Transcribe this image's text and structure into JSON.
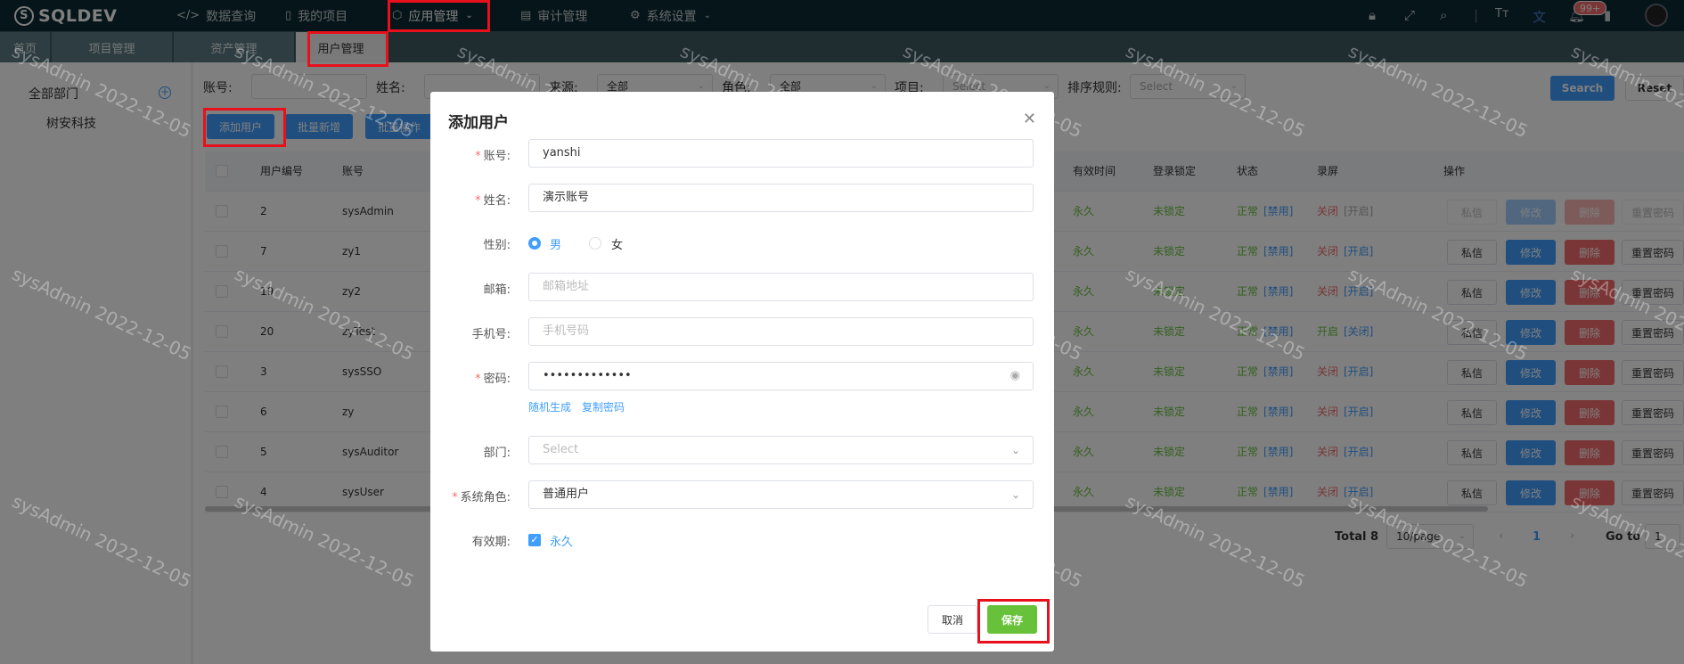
{
  "app": {
    "logo": "SQLDEV"
  },
  "nav": [
    {
      "label": "数据查询",
      "icon": "code-icon"
    },
    {
      "label": "我的项目",
      "icon": "book-icon"
    },
    {
      "label": "应用管理",
      "icon": "cube-icon"
    },
    {
      "label": "审计管理",
      "icon": "document-icon"
    },
    {
      "label": "系统设置",
      "icon": "gear-icon"
    }
  ],
  "notifications": {
    "badge": "99+"
  },
  "tabs": [
    "首页",
    "项目管理",
    "资产管理",
    "用户管理"
  ],
  "sidebar": {
    "title": "全部部门",
    "node": "树安科技"
  },
  "filters": {
    "account_label": "账号:",
    "name_label": "姓名:",
    "source_label": "来源:",
    "source_value": "全部",
    "role_label": "角色:",
    "role_value": "全部",
    "project_label": "项目:",
    "project_value": "Select",
    "sort_label": "排序规则:",
    "sort_value": "Select",
    "search_button": "Search",
    "reset_button": "Reset"
  },
  "actions": {
    "add_user": "添加用户",
    "batch_add": "批量新增",
    "batch_op": "批量操作"
  },
  "table": {
    "headers": {
      "id": "用户编号",
      "account": "账号",
      "valid": "有效时间",
      "lock": "登录锁定",
      "status": "状态",
      "record": "录屏",
      "ops": "操作"
    },
    "rows": [
      {
        "id": "2",
        "account": "sysAdmin",
        "valid": "永久",
        "lock": "未锁定",
        "status": "正常",
        "status_action": "[禁用]",
        "record": "关闭",
        "record_action": "[开启]",
        "disabled": true
      },
      {
        "id": "7",
        "account": "zy1",
        "valid": "永久",
        "lock": "未锁定",
        "status": "正常",
        "status_action": "[禁用]",
        "record": "关闭",
        "record_action": "[开启]",
        "disabled": false
      },
      {
        "id": "19",
        "account": "zy2",
        "valid": "永久",
        "lock": "未锁定",
        "status": "正常",
        "status_action": "[禁用]",
        "record": "关闭",
        "record_action": "[开启]",
        "disabled": false
      },
      {
        "id": "20",
        "account": "zyTest",
        "valid": "永久",
        "lock": "未锁定",
        "status": "正常",
        "status_action": "[禁用]",
        "record": "开启",
        "record_action": "[关闭]",
        "disabled": false
      },
      {
        "id": "3",
        "account": "sysSSO",
        "valid": "永久",
        "lock": "未锁定",
        "status": "正常",
        "status_action": "[禁用]",
        "record": "关闭",
        "record_action": "[开启]",
        "disabled": false
      },
      {
        "id": "6",
        "account": "zy",
        "valid": "永久",
        "lock": "未锁定",
        "status": "正常",
        "status_action": "[禁用]",
        "record": "关闭",
        "record_action": "[开启]",
        "disabled": false
      },
      {
        "id": "5",
        "account": "sysAuditor",
        "valid": "永久",
        "lock": "未锁定",
        "status": "正常",
        "status_action": "[禁用]",
        "record": "关闭",
        "record_action": "[开启]",
        "disabled": false
      },
      {
        "id": "4",
        "account": "sysUser",
        "valid": "永久",
        "lock": "未锁定",
        "status": "正常",
        "status_action": "[禁用]",
        "record": "关闭",
        "record_action": "[开启]",
        "disabled": false
      }
    ],
    "row_actions": {
      "message": "私信",
      "edit": "修改",
      "delete": "删除",
      "reset_pwd": "重置密码"
    }
  },
  "pager": {
    "total": "Total 8",
    "page_size": "10/page",
    "current": "1",
    "goto": "Go to",
    "goto_value": "1"
  },
  "watermark": "sysAdmin 2022-12-05",
  "modal": {
    "title": "添加用户",
    "fields": {
      "account_label": "账号:",
      "account_value": "yanshi",
      "name_label": "姓名:",
      "name_value": "演示账号",
      "gender_label": "性别:",
      "gender_male": "男",
      "gender_female": "女",
      "email_label": "邮箱:",
      "email_placeholder": "邮箱地址",
      "phone_label": "手机号:",
      "phone_placeholder": "手机号码",
      "password_label": "密码:",
      "password_value": "•••••••••••••",
      "random_link": "随机生成",
      "copy_link": "复制密码",
      "dept_label": "部门:",
      "dept_placeholder": "Select",
      "role_label": "系统角色:",
      "role_value": "普通用户",
      "valid_label": "有效期:",
      "valid_value": "永久"
    },
    "cancel_button": "取消",
    "save_button": "保存"
  },
  "colors": {
    "accent": "#409eff",
    "danger": "#f56c6c",
    "success": "#67c23a",
    "save": "#67c23a",
    "highlight": "#e8101a",
    "topbar": "#0d2a33"
  }
}
